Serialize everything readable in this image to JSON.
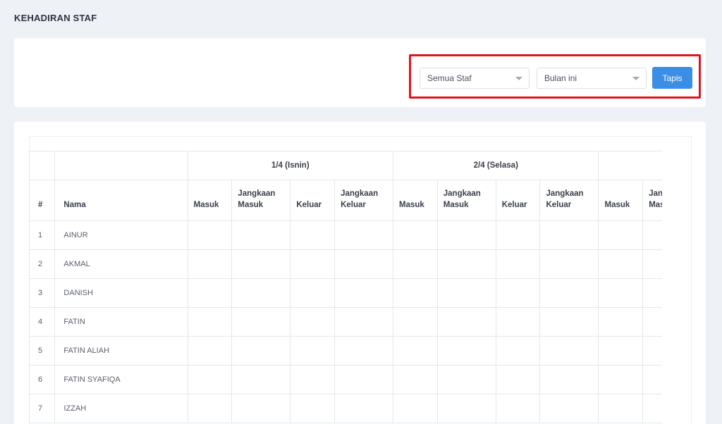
{
  "page": {
    "title": "KEHADIRAN STAF"
  },
  "filters": {
    "staff_select": {
      "value": "Semua Staf"
    },
    "period_select": {
      "value": "Bulan ini"
    },
    "submit_label": "Tapis",
    "highlight_color": "#e0141e",
    "button_color": "#3a8ee6"
  },
  "table": {
    "col_num": "#",
    "col_name": "Nama",
    "days": [
      {
        "label": "1/4 (Isnin)"
      },
      {
        "label": "2/4 (Selasa)"
      },
      {
        "label": ""
      }
    ],
    "sub_headers": [
      "Masuk",
      "Jangkaan Masuk",
      "Keluar",
      "Jangkaan Keluar"
    ],
    "rows": [
      {
        "num": "1",
        "name": "AINUR"
      },
      {
        "num": "2",
        "name": "AKMAL"
      },
      {
        "num": "3",
        "name": "DANISH"
      },
      {
        "num": "4",
        "name": "FATIN"
      },
      {
        "num": "5",
        "name": "FATIN ALIAH"
      },
      {
        "num": "6",
        "name": "FATIN SYAFIQA"
      },
      {
        "num": "7",
        "name": "IZZAH"
      }
    ]
  }
}
